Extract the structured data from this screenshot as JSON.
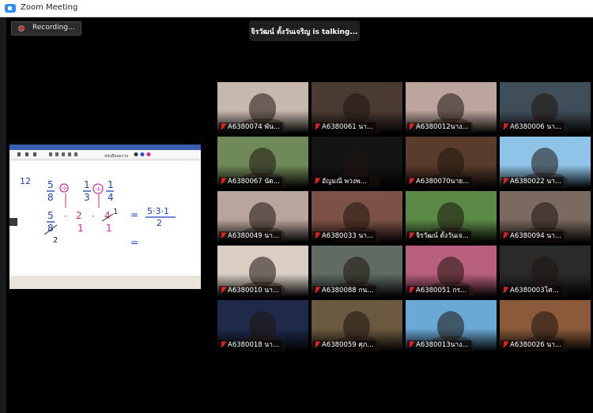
{
  "window": {
    "title": "Zoom Meeting"
  },
  "recording": {
    "label": "Recording..."
  },
  "talking": {
    "text": "จิรวัฒน์ ตั้งวันเจริญ is talking..."
  },
  "share": {
    "app_title": "หนังสือจดงาน",
    "problem_number": "12",
    "row1": [
      "5",
      "8",
      "1",
      "3",
      "1",
      "4"
    ],
    "row2": [
      "5",
      "8",
      "2",
      "1",
      "4",
      "1"
    ],
    "overflow_digit": "1",
    "result_numerator": "5·3·1",
    "result_denominator": "2",
    "crossed_denominator_result": "2"
  },
  "tiles": [
    {
      "name": "A6380074 พัน...",
      "bg": "#c7b8ad"
    },
    {
      "name": "A6380061 นา...",
      "bg": "#4a3b32"
    },
    {
      "name": "A6380012นาง...",
      "bg": "#bba59c"
    },
    {
      "name": "A6380006 นา...",
      "bg": "#3f4e59"
    },
    {
      "name": "A6380067 นัด...",
      "bg": "#6f8a58"
    },
    {
      "name": "อัญมณี พวงพ...",
      "bg": "#141414"
    },
    {
      "name": "A6380070นาย...",
      "bg": "#5a3c2c"
    },
    {
      "name": "A6380022 นา...",
      "bg": "#8fc4e8"
    },
    {
      "name": "A6380049 นา...",
      "bg": "#b9a59b"
    },
    {
      "name": "A6380033 นา...",
      "bg": "#7d5246"
    },
    {
      "name": "จิรวัฒน์ ตั้งวันเจ...",
      "bg": "#5a8a45"
    },
    {
      "name": "A6380094 นา...",
      "bg": "#7b6a60"
    },
    {
      "name": "A6380010 นา...",
      "bg": "#d9cdc4"
    },
    {
      "name": "A6380088 กน...",
      "bg": "#5f6b63"
    },
    {
      "name": "A6380051 กร...",
      "bg": "#b85f7d"
    },
    {
      "name": "A6380003โศ...",
      "bg": "#2a2a2a"
    },
    {
      "name": "A6380018 นา...",
      "bg": "#1f2a4a"
    },
    {
      "name": "A6380059 ศุภ...",
      "bg": "#6b5a40"
    },
    {
      "name": "A6380013นาง...",
      "bg": "#6aa9d6"
    },
    {
      "name": "A6380026 นา...",
      "bg": "#8a5a3a"
    }
  ]
}
